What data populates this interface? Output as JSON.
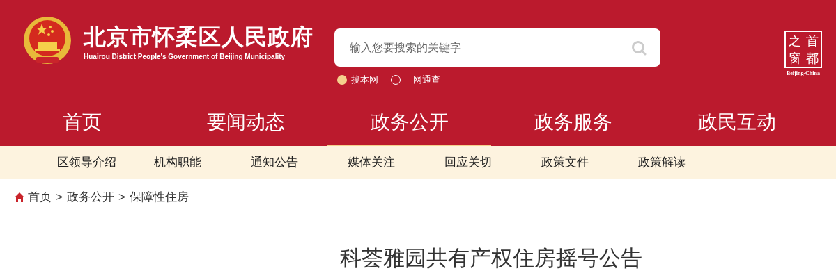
{
  "header": {
    "title": "北京市怀柔区人民政府",
    "subtitle": "Huairou District People's Government of Beijing Municipality",
    "search": {
      "placeholder": "输入您要搜索的关键字"
    },
    "search_scopes": [
      {
        "label": "搜本网",
        "selected": true
      },
      {
        "label": "网通查",
        "selected": false
      }
    ],
    "capital_logo": {
      "chars": [
        "之",
        "首",
        "窗",
        "都"
      ],
      "caption": "Beijing-China"
    }
  },
  "nav": [
    {
      "label": "首页",
      "selected": false
    },
    {
      "label": "要闻动态",
      "selected": false
    },
    {
      "label": "政务公开",
      "selected": true
    },
    {
      "label": "政务服务",
      "selected": false
    },
    {
      "label": "政民互动",
      "selected": false
    }
  ],
  "subnav": [
    "区领导介绍",
    "机构职能",
    "通知公告",
    "媒体关注",
    "回应关切",
    "政策文件",
    "政策解读"
  ],
  "breadcrumb": {
    "separator": ">",
    "items": [
      "首页",
      "政务公开",
      "保障性住房"
    ]
  },
  "article": {
    "title": "科荟雅园共有产权住房摇号公告"
  }
}
